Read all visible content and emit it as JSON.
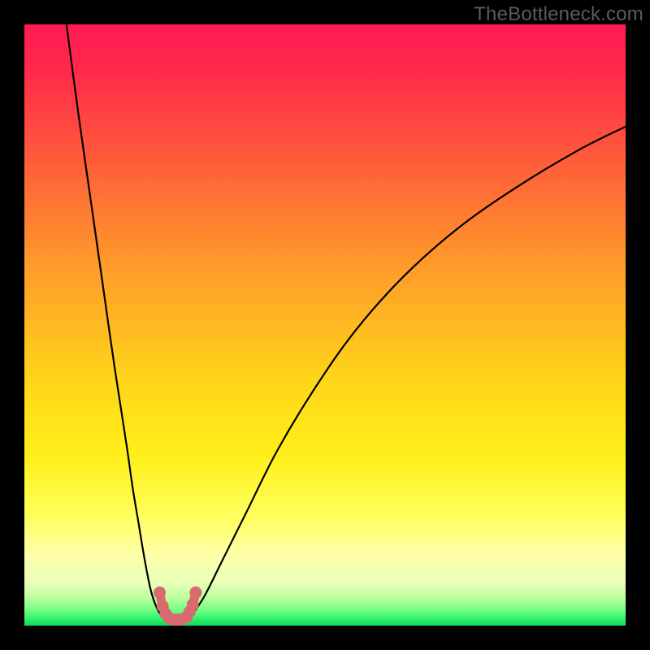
{
  "watermark": "TheBottleneck.com",
  "chart_data": {
    "type": "line",
    "title": "",
    "xlabel": "",
    "ylabel": "",
    "xlim": [
      0,
      100
    ],
    "ylim": [
      0,
      100
    ],
    "series": [
      {
        "name": "left-curve",
        "x": [
          7,
          9,
          11,
          13,
          15,
          17,
          18,
          19,
          20,
          21,
          22,
          23,
          24
        ],
        "y": [
          100,
          85,
          71,
          57,
          43,
          30,
          23,
          17,
          11,
          6,
          3,
          1.5,
          1
        ]
      },
      {
        "name": "right-curve",
        "x": [
          27,
          28,
          30,
          33,
          37,
          42,
          48,
          55,
          63,
          72,
          82,
          92,
          100
        ],
        "y": [
          1,
          2,
          5,
          11,
          19,
          29,
          39,
          49,
          58,
          66,
          73,
          79,
          83
        ]
      },
      {
        "name": "marker-u",
        "x": [
          22.5,
          23,
          23.5,
          24,
          24.8,
          25.5,
          26.3,
          27,
          27.5,
          28,
          28.5
        ],
        "y": [
          5.5,
          3.2,
          2.0,
          1.3,
          1.0,
          1.0,
          1.1,
          1.5,
          2.3,
          3.5,
          5.5
        ]
      }
    ],
    "gradient_stops": [
      {
        "offset": 0.0,
        "color": "#ff1a54"
      },
      {
        "offset": 0.08,
        "color": "#ff2a4a"
      },
      {
        "offset": 0.22,
        "color": "#ff5a3a"
      },
      {
        "offset": 0.4,
        "color": "#ff9a2a"
      },
      {
        "offset": 0.58,
        "color": "#ffd21a"
      },
      {
        "offset": 0.72,
        "color": "#fff01a"
      },
      {
        "offset": 0.82,
        "color": "#ffff60"
      },
      {
        "offset": 0.88,
        "color": "#ffffa8"
      },
      {
        "offset": 0.93,
        "color": "#e8ffb8"
      },
      {
        "offset": 0.955,
        "color": "#b8ff9a"
      },
      {
        "offset": 0.975,
        "color": "#70ff82"
      },
      {
        "offset": 0.99,
        "color": "#2aef6a"
      },
      {
        "offset": 1.0,
        "color": "#14d860"
      }
    ],
    "marker_color": "#d96a6e",
    "curve_color": "#000000"
  }
}
